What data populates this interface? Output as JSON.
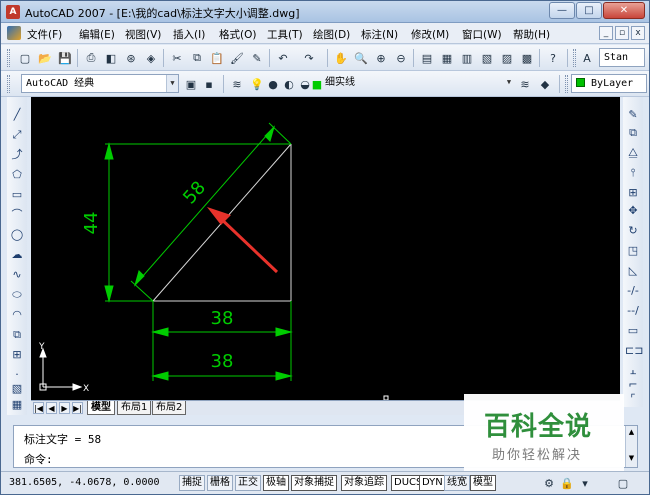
{
  "window": {
    "title": "AutoCAD 2007 - [E:\\我的cad\\标注文字大小调整.dwg]",
    "controls": {
      "minimize": "—",
      "maximize": "□",
      "close": "✕"
    }
  },
  "menubar": {
    "items": [
      "文件(F)",
      "编辑(E)",
      "视图(V)",
      "插入(I)",
      "格式(O)",
      "工具(T)",
      "绘图(D)",
      "标注(N)",
      "修改(M)",
      "窗口(W)",
      "帮助(H)"
    ],
    "mdi_controls": {
      "minimize": "_",
      "restore": "▫",
      "close": "x"
    }
  },
  "toolbar": {
    "style_combo": "Stan",
    "workspace": "AutoCAD 经典",
    "layer": "细实线",
    "color": "ByLayer"
  },
  "drawing": {
    "aligned_dim": "58",
    "vertical_dim": "44",
    "horizontal_dim_1": "38",
    "horizontal_dim_2": "38",
    "ucs_x": "X",
    "ucs_y": "Y",
    "colors": {
      "background": "#000000",
      "dimension": "#00cc00",
      "geometry": "#ffffff",
      "arrow": "#e8322b"
    }
  },
  "tabs": {
    "items": [
      "模型",
      "布局1",
      "布局2"
    ],
    "active": "模型"
  },
  "command": {
    "history": "标注文字 = 58",
    "prompt": "命令:"
  },
  "statusbar": {
    "coords": "381.6505, -4.0678, 0.0000",
    "buttons": [
      "捕捉",
      "栅格",
      "正交",
      "极轴",
      "对象捕捉",
      "对象追踪",
      "DUCS",
      "DYN",
      "线宽",
      "模型"
    ]
  },
  "watermark": {
    "main": "百科全说",
    "sub": "助你轻松解决"
  }
}
